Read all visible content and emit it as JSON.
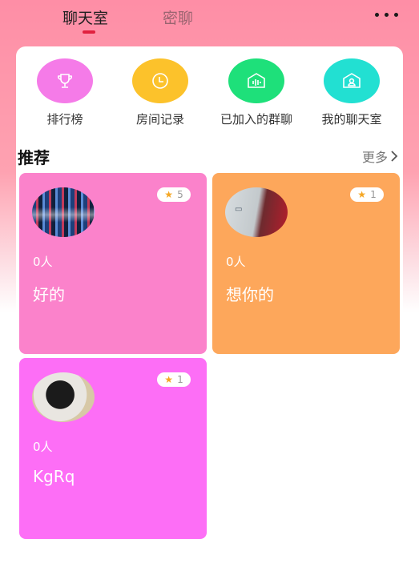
{
  "header": {
    "tabs": [
      {
        "label": "聊天室",
        "active": true
      },
      {
        "label": "密聊",
        "active": false
      }
    ],
    "menu_icon": "more-dots-icon"
  },
  "quick_links": [
    {
      "label": "排行榜",
      "icon": "trophy-icon",
      "color": "#f57be8"
    },
    {
      "label": "房间记录",
      "icon": "clock-icon",
      "color": "#fcc22b"
    },
    {
      "label": "已加入的群聊",
      "icon": "group-chat-icon",
      "color": "#1ee07a"
    },
    {
      "label": "我的聊天室",
      "icon": "home-user-icon",
      "color": "#22e0d2"
    }
  ],
  "section": {
    "title": "推荐",
    "more_label": "更多"
  },
  "rooms": [
    {
      "stars": "5",
      "count": "0人",
      "name": "好的",
      "color": "#fb82cb"
    },
    {
      "stars": "1",
      "count": "0人",
      "name": "想你的",
      "color": "#fda75b"
    },
    {
      "stars": "1",
      "count": "0人",
      "name": "KgRq",
      "color": "#fd6ef6"
    }
  ]
}
